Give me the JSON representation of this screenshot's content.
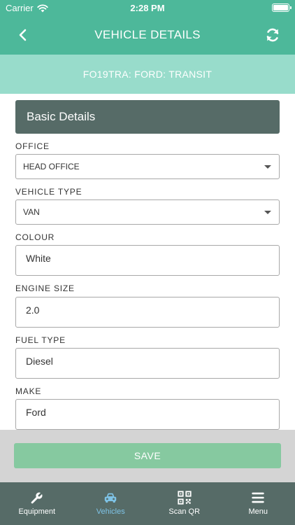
{
  "status_bar": {
    "carrier": "Carrier",
    "time": "2:28 PM"
  },
  "nav": {
    "title": "VEHICLE DETAILS",
    "back_icon": "chevron-left-icon",
    "refresh_icon": "refresh-icon"
  },
  "vehicle_header": {
    "text": "FO19TRA: FORD: TRANSIT"
  },
  "section": {
    "title": "Basic Details"
  },
  "fields": {
    "office": {
      "label": "OFFICE",
      "value": "HEAD OFFICE"
    },
    "vehicle_type": {
      "label": "VEHICLE TYPE",
      "value": "VAN"
    },
    "colour": {
      "label": "COLOUR",
      "value": "White"
    },
    "engine_size": {
      "label": "ENGINE SIZE",
      "value": "2.0"
    },
    "fuel_type": {
      "label": "FUEL TYPE",
      "value": "Diesel"
    },
    "make": {
      "label": "MAKE",
      "value": "Ford"
    }
  },
  "save": {
    "label": "SAVE"
  },
  "tabs": [
    {
      "label": "Equipment",
      "icon": "wrench-icon",
      "active": false
    },
    {
      "label": "Vehicles",
      "icon": "car-icon",
      "active": true
    },
    {
      "label": "Scan QR",
      "icon": "qr-code-icon",
      "active": false
    },
    {
      "label": "Menu",
      "icon": "hamburger-menu-icon",
      "active": false
    }
  ],
  "colors": {
    "primary": "#4db89a",
    "sub_header": "#98dccb",
    "section_header": "#566b67",
    "save_button": "#86c9a0",
    "active_tab": "#7ec3e6"
  }
}
